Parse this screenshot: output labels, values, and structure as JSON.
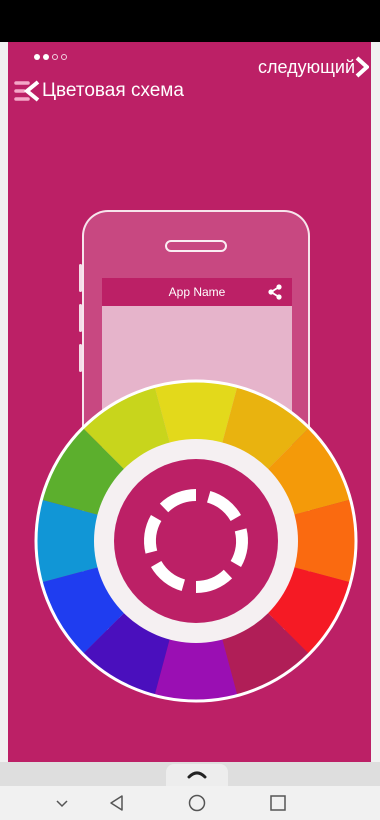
{
  "onboarding": {
    "title": "Цветовая схема",
    "next_label": "следующий",
    "page_indicator": {
      "total": 4,
      "current": 2
    }
  },
  "preview_phone": {
    "app_name": "App Name"
  },
  "icons": {
    "back": "back-arrow-icon",
    "next": "chevron-right-icon",
    "share": "share-icon",
    "palette": "color-wheel-icon",
    "expand": "chevron-up-icon",
    "nav": [
      "chevron-down-icon",
      "triangle-back-icon",
      "circle-home-icon",
      "square-recents-icon"
    ]
  },
  "colors": {
    "primary": "#bc2066",
    "wheel": [
      "#e3d91b",
      "#e9b30f",
      "#f49a09",
      "#fa6a10",
      "#f51a24",
      "#b01e57",
      "#9a0fb3",
      "#4a0fbd",
      "#1f3df0",
      "#1196d6",
      "#5caf2d",
      "#c8d51c"
    ]
  }
}
